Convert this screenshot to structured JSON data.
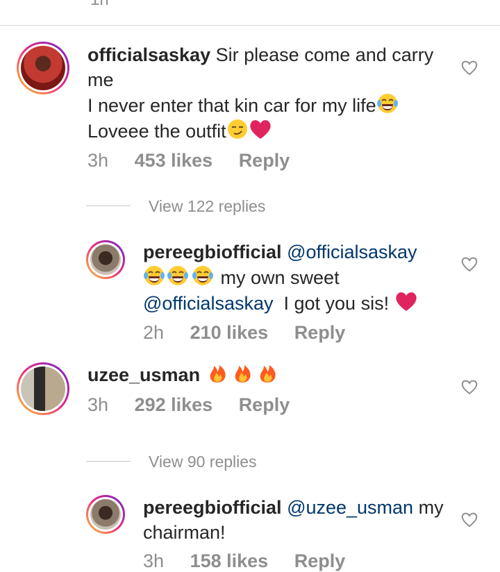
{
  "top_cut_text": "1h",
  "comments": [
    {
      "username": "officialsaskay",
      "line1": "Sir please come and carry me",
      "line2": "I never enter that kin car for my life",
      "line3": "Loveee the outfit",
      "time": "3h",
      "likes": "453 likes",
      "reply": "Reply",
      "view_replies": "View 122 replies"
    },
    {
      "username": "pereegbiofficial",
      "mention1": "@officialsaskay",
      "text1": "my own sweet",
      "mention2": "@officialsaskay",
      "text2": "I got you sis!",
      "time": "2h",
      "likes": "210 likes",
      "reply": "Reply"
    },
    {
      "username": "uzee_usman",
      "time": "3h",
      "likes": "292 likes",
      "reply": "Reply",
      "view_replies": "View 90 replies"
    },
    {
      "username": "pereegbiofficial",
      "mention1": "@uzee_usman",
      "text1": "my chairman!",
      "time": "3h",
      "likes": "158 likes",
      "reply": "Reply"
    }
  ],
  "colors": {
    "mention": "#00376b",
    "meta": "#8e8e8e",
    "heart": "#e0245e",
    "fire": "#ff5a1f"
  },
  "icons": [
    "heart-outline-icon",
    "tears-of-joy-emoji",
    "smirk-emoji",
    "red-heart-emoji",
    "fire-emoji"
  ]
}
